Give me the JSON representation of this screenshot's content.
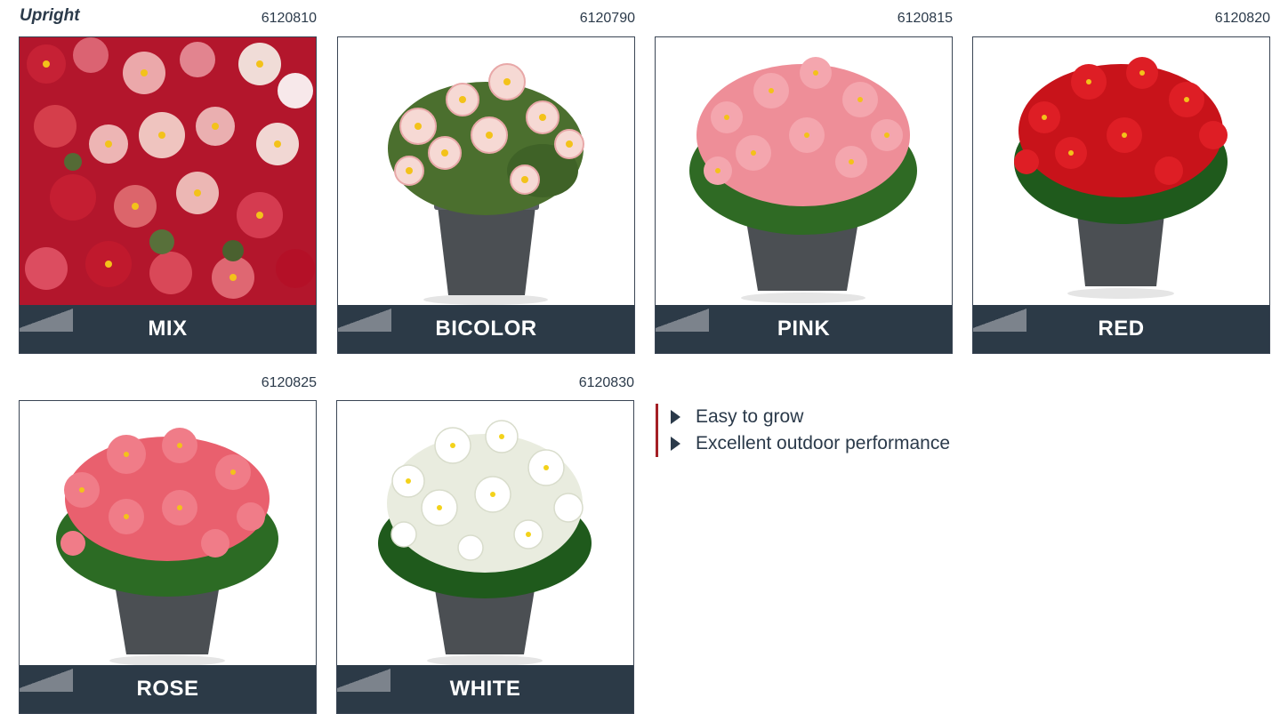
{
  "section_title": "Upright",
  "products": [
    {
      "code": "6120810",
      "name": "MIX",
      "image": "begonia-mix-flowers-closeup"
    },
    {
      "code": "6120790",
      "name": "BICOLOR",
      "image": "begonia-bicolor-potted"
    },
    {
      "code": "6120815",
      "name": "PINK",
      "image": "begonia-pink-potted"
    },
    {
      "code": "6120820",
      "name": "RED",
      "image": "begonia-red-potted"
    },
    {
      "code": "6120825",
      "name": "ROSE",
      "image": "begonia-rose-potted"
    },
    {
      "code": "6120830",
      "name": "WHITE",
      "image": "begonia-white-potted"
    }
  ],
  "features": [
    "Easy to grow",
    "Excellent outdoor performance"
  ],
  "colors": {
    "label_bar": "#2c3a47",
    "accent_rule": "#a41f25",
    "text": "#2b3a4a"
  }
}
